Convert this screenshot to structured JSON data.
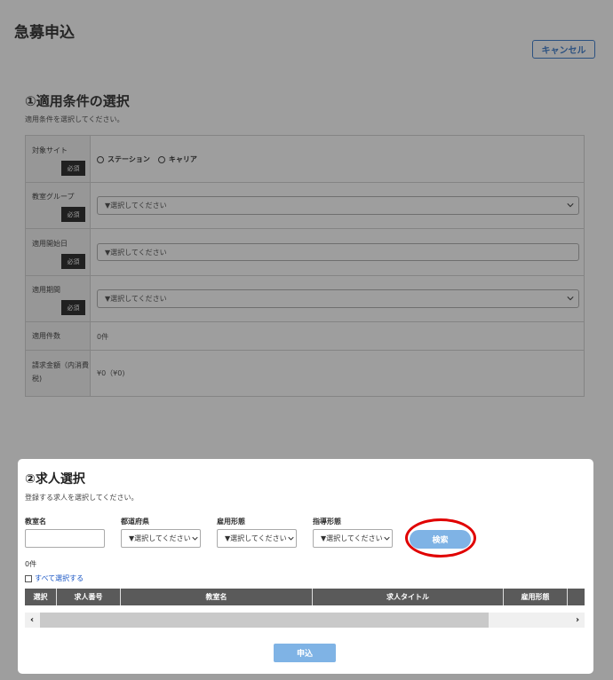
{
  "header": {
    "title": "急募申込",
    "cancel_label": "キャンセル"
  },
  "section1": {
    "title": "①適用条件の選択",
    "description": "適用条件を選択してください。",
    "required_label": "必須",
    "rows": {
      "site": {
        "label": "対象サイト",
        "options": [
          "ステーション",
          "キャリア"
        ]
      },
      "group": {
        "label": "教室グループ",
        "placeholder": "▼選択してください"
      },
      "start_date": {
        "label": "適用開始日",
        "placeholder": "▼選択してください"
      },
      "period": {
        "label": "適用期間",
        "placeholder": "▼選択してください"
      },
      "count": {
        "label": "適用件数",
        "value": "0件"
      },
      "amount": {
        "label": "請求金額（内消費税)",
        "value": "¥0（¥0)"
      }
    }
  },
  "section2": {
    "title": "②求人選択",
    "description": "登録する求人を選択してください。",
    "filters": {
      "classroom_label": "教室名",
      "prefecture_label": "都道府県",
      "employment_label": "雇用形態",
      "teaching_label": "指導形態",
      "select_placeholder": "▼選択してください"
    },
    "search_label": "検索",
    "result_count": "0件",
    "select_all_label": "すべて選択する",
    "columns": [
      "選択",
      "求人番号",
      "教室名",
      "求人タイトル",
      "雇用形態"
    ],
    "apply_label": "申込"
  },
  "colors": {
    "accent": "#2f73c9",
    "button_light": "#7fb3e5",
    "highlight": "#e00000",
    "header_dark": "#5a5a5a"
  }
}
